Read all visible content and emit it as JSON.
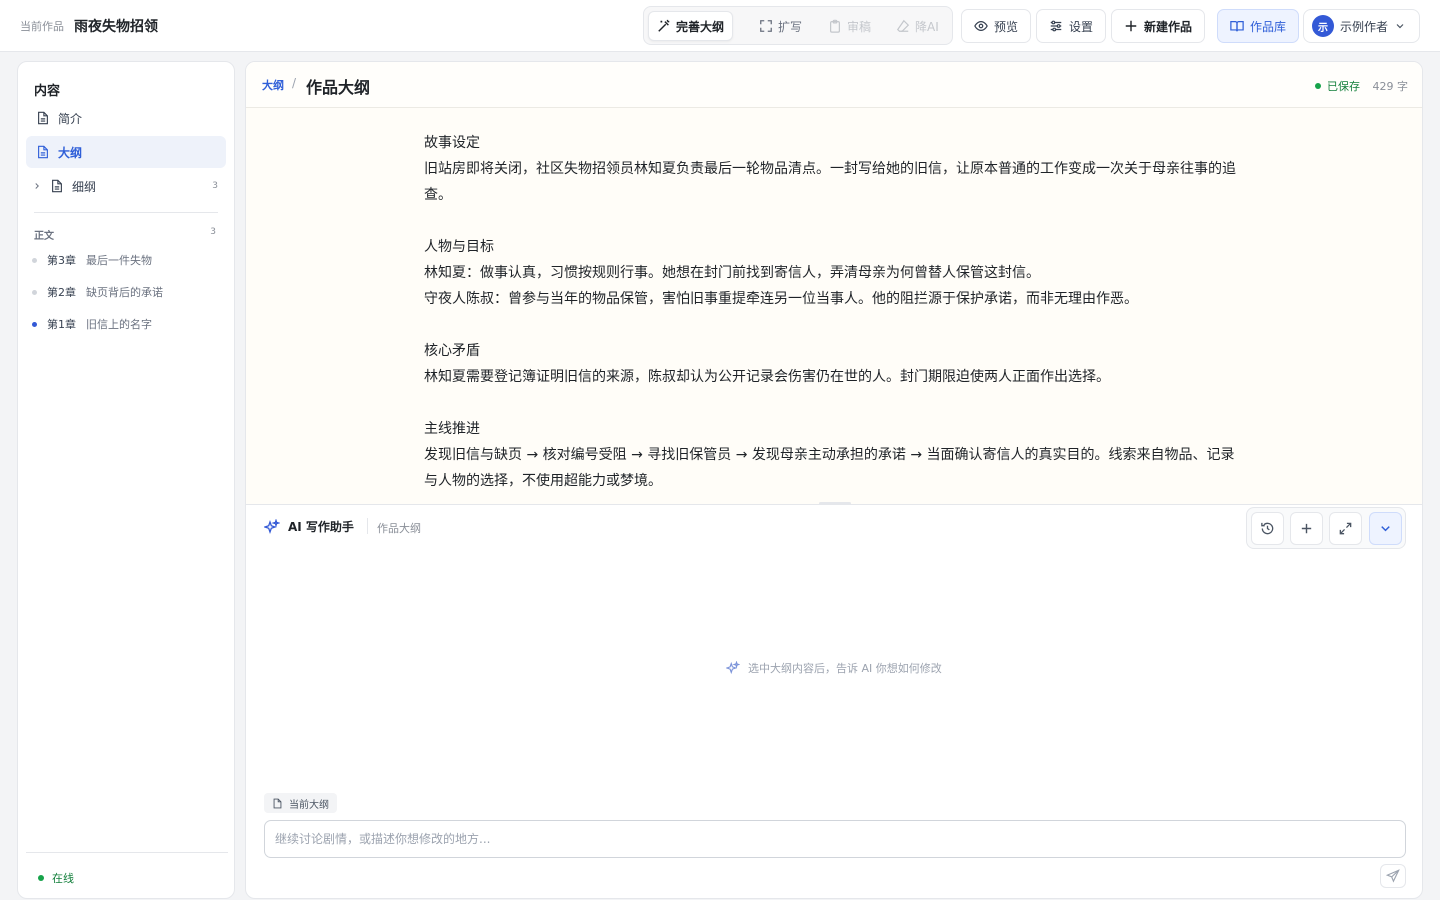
{
  "header": {
    "current_label": "当前作品",
    "work_title": "雨夜失物招领",
    "modes": [
      {
        "label": "完善大纲",
        "state": "active"
      },
      {
        "label": "扩写",
        "state": "normal"
      },
      {
        "label": "审稿",
        "state": "disabled"
      },
      {
        "label": "降AI",
        "state": "disabled"
      }
    ],
    "preview_label": "预览",
    "settings_label": "设置",
    "new_work_label": "新建作品",
    "library_label": "作品库",
    "user": {
      "avatar_char": "示",
      "name": "示例作者"
    }
  },
  "sidebar": {
    "heading": "内容",
    "items": [
      {
        "label": "简介"
      },
      {
        "label": "大纲",
        "active": true
      },
      {
        "label": "细纲",
        "count": "3"
      }
    ],
    "section_label": "正文",
    "section_count": "3",
    "chapters": [
      {
        "no": "第3章",
        "title": "最后一件失物",
        "current": false
      },
      {
        "no": "第2章",
        "title": "缺页背后的承诺",
        "current": false
      },
      {
        "no": "第1章",
        "title": "旧信上的名字",
        "current": true
      }
    ],
    "status": "在线"
  },
  "editor": {
    "breadcrumb": "大纲",
    "breadcrumb_sep": "/",
    "title": "作品大纲",
    "saved_status": "已保存",
    "word_count": "429 字",
    "blocks": [
      {
        "heading": "故事设定",
        "lines": [
          "旧站房即将关闭，社区失物招领员林知夏负责最后一轮物品清点。一封写给她的旧信，让原本普通的工作变成一次关于母亲往事的追查。"
        ]
      },
      {
        "heading": "人物与目标",
        "lines": [
          "林知夏：做事认真，习惯按规则行事。她想在封门前找到寄信人，弄清母亲为何曾替人保管这封信。",
          "守夜人陈叔：曾参与当年的物品保管，害怕旧事重提牵连另一位当事人。他的阻拦源于保护承诺，而非无理由作恶。"
        ]
      },
      {
        "heading": "核心矛盾",
        "lines": [
          "林知夏需要登记簿证明旧信的来源，陈叔却认为公开记录会伤害仍在世的人。封门期限迫使两人正面作出选择。"
        ]
      },
      {
        "heading": "主线推进",
        "lines": [
          "发现旧信与缺页 → 核对编号受阻 → 寻找旧保管员 → 发现母亲主动承担的承诺 → 当面确认寄信人的真实目的。线索来自物品、记录与人物的选择，不使用超能力或梦境。"
        ]
      }
    ]
  },
  "assistant": {
    "title": "AI 写作助手",
    "context": "作品大纲",
    "empty_hint": "选中大纲内容后，告诉 AI 你想如何修改",
    "context_chip": "当前大纲",
    "input_placeholder": "继续讨论剧情，或描述你想修改的地方...",
    "input_value": ""
  },
  "colors": {
    "accent": "#2f5fd8",
    "success": "#16a34a",
    "editor_bg": "#fffdf8"
  }
}
